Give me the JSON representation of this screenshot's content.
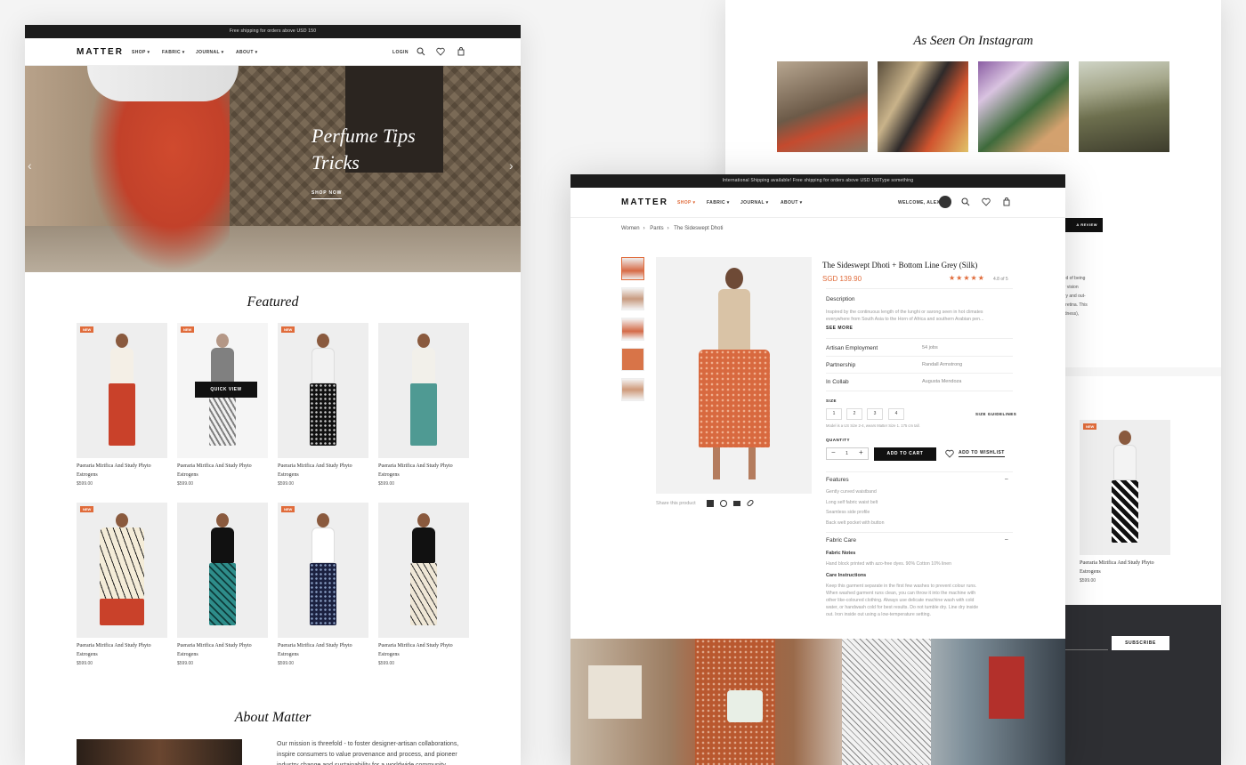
{
  "left": {
    "topbar": "Free shipping for orders above USD 150",
    "logo": "MATTER",
    "nav": [
      "SHOP",
      "FABRIC",
      "JOURNAL",
      "ABOUT"
    ],
    "login": "LOGIN",
    "hero": {
      "title_line1": "Perfume Tips",
      "title_line2": "Tricks",
      "cta": "SHOP NOW"
    },
    "featured_title": "Featured",
    "quick_view": "QUICK VIEW",
    "badge": "NEW",
    "products": [
      {
        "name_line1": "Pueraria Mirifica And Study Phyto",
        "name_line2": "Estrogens",
        "price": "$599.00"
      },
      {
        "name_line1": "Pueraria Mirifica And Study Phyto",
        "name_line2": "Estrogens",
        "price": "$599.00"
      },
      {
        "name_line1": "Pueraria Mirifica And Study Phyto",
        "name_line2": "Estrogens",
        "price": "$599.00"
      },
      {
        "name_line1": "Pueraria Mirifica And Study Phyto",
        "name_line2": "Estrogens",
        "price": "$599.00"
      },
      {
        "name_line1": "Pueraria Mirifica And Study Phyto",
        "name_line2": "Estrogens",
        "price": "$599.00"
      },
      {
        "name_line1": "Pueraria Mirifica And Study Phyto",
        "name_line2": "Estrogens",
        "price": "$599.00"
      },
      {
        "name_line1": "Pueraria Mirifica And Study Phyto",
        "name_line2": "Estrogens",
        "price": "$599.00"
      },
      {
        "name_line1": "Pueraria Mirifica And Study Phyto",
        "name_line2": "Estrogens",
        "price": "$599.00"
      }
    ],
    "about_title": "About Matter",
    "about_text": "Our mission is threefold - to foster designer-artisan collaborations, inspire consumers to value provenance and process, and pioneer industry change and sustainability for a worldwide community."
  },
  "right": {
    "instagram_title": "As Seen On Instagram",
    "review_button": "A REVIEW",
    "peek_text_lines": [
      "ur vision",
      "ury and out-",
      "e retina. This",
      "edness),"
    ],
    "peek_text_top": "red of being",
    "product": {
      "badge": "NEW",
      "name_line1": "Pueraria Mirifica And Study Phyto",
      "name_line2": "Estrogens",
      "price": "$599.00"
    },
    "subscribe": "SUBSCRIBE"
  },
  "product": {
    "topbar": "International Shipping available! Free shipping for orders above USD 150Type something",
    "logo": "MATTER",
    "nav": [
      "SHOP",
      "FABRIC",
      "JOURNAL",
      "ABOUT"
    ],
    "welcome": "WELCOME, ALEX",
    "breadcrumb": [
      "Women",
      "Pants",
      "The Sideswept Dhoti"
    ],
    "title": "The Sideswept Dhoti + Bottom Line Grey (Silk)",
    "price": "SGD 139.90",
    "stars": "★★★★★",
    "rating": "4.8 of 5",
    "description_label": "Description",
    "description_text_1": "Inspired by the continuous length of the lunghi or sarong seen in hot climates",
    "description_text_2": "everywhere from South Asia to the Horn of Africa and southern Arabian pen...",
    "see_more": "SEE MORE",
    "details": [
      {
        "label": "Artisan Employment",
        "value": "54 jobs"
      },
      {
        "label": "Partnership",
        "value": "Randall Armstrong"
      },
      {
        "label": "In Collab",
        "value": "Augusta Mendoza"
      }
    ],
    "size_label": "SIZE",
    "sizes": [
      "1",
      "2",
      "3",
      "4"
    ],
    "size_guidelines": "SIZE GUIDELINES",
    "size_note": "Model is a US Size 2-4, wears Matter Size 1. 175 cm tall.",
    "quantity_label": "QUANTITY",
    "quantity": "1",
    "add_to_cart": "ADD TO CART",
    "add_to_wishlist": "ADD TO WISHLIST",
    "share_label": "Share this product",
    "features_label": "Features",
    "features": [
      "Gently curved waistband",
      "Long self fabric waist belt",
      "Seamless side profile",
      "Back welt pocket with button"
    ],
    "fabric_care_label": "Fabric Care",
    "fabric_notes_label": "Fabric Notes",
    "fabric_notes_text": "Hand block printed with azo-free dyes. 90% Cotton 10% linen",
    "care_label": "Care Instructions",
    "care_lines": [
      "Keep this garment separate in the first few washes to prevent colour runs.",
      "When washed garment runs clean, you can throw it into the machine with",
      "other like-coloured clothing. Always use delicate machine wash with cold",
      "water, or handwash cold for best results. Do not tumble dry. Line dry inside",
      "out. Iron inside out using a low-temperature setting."
    ]
  }
}
